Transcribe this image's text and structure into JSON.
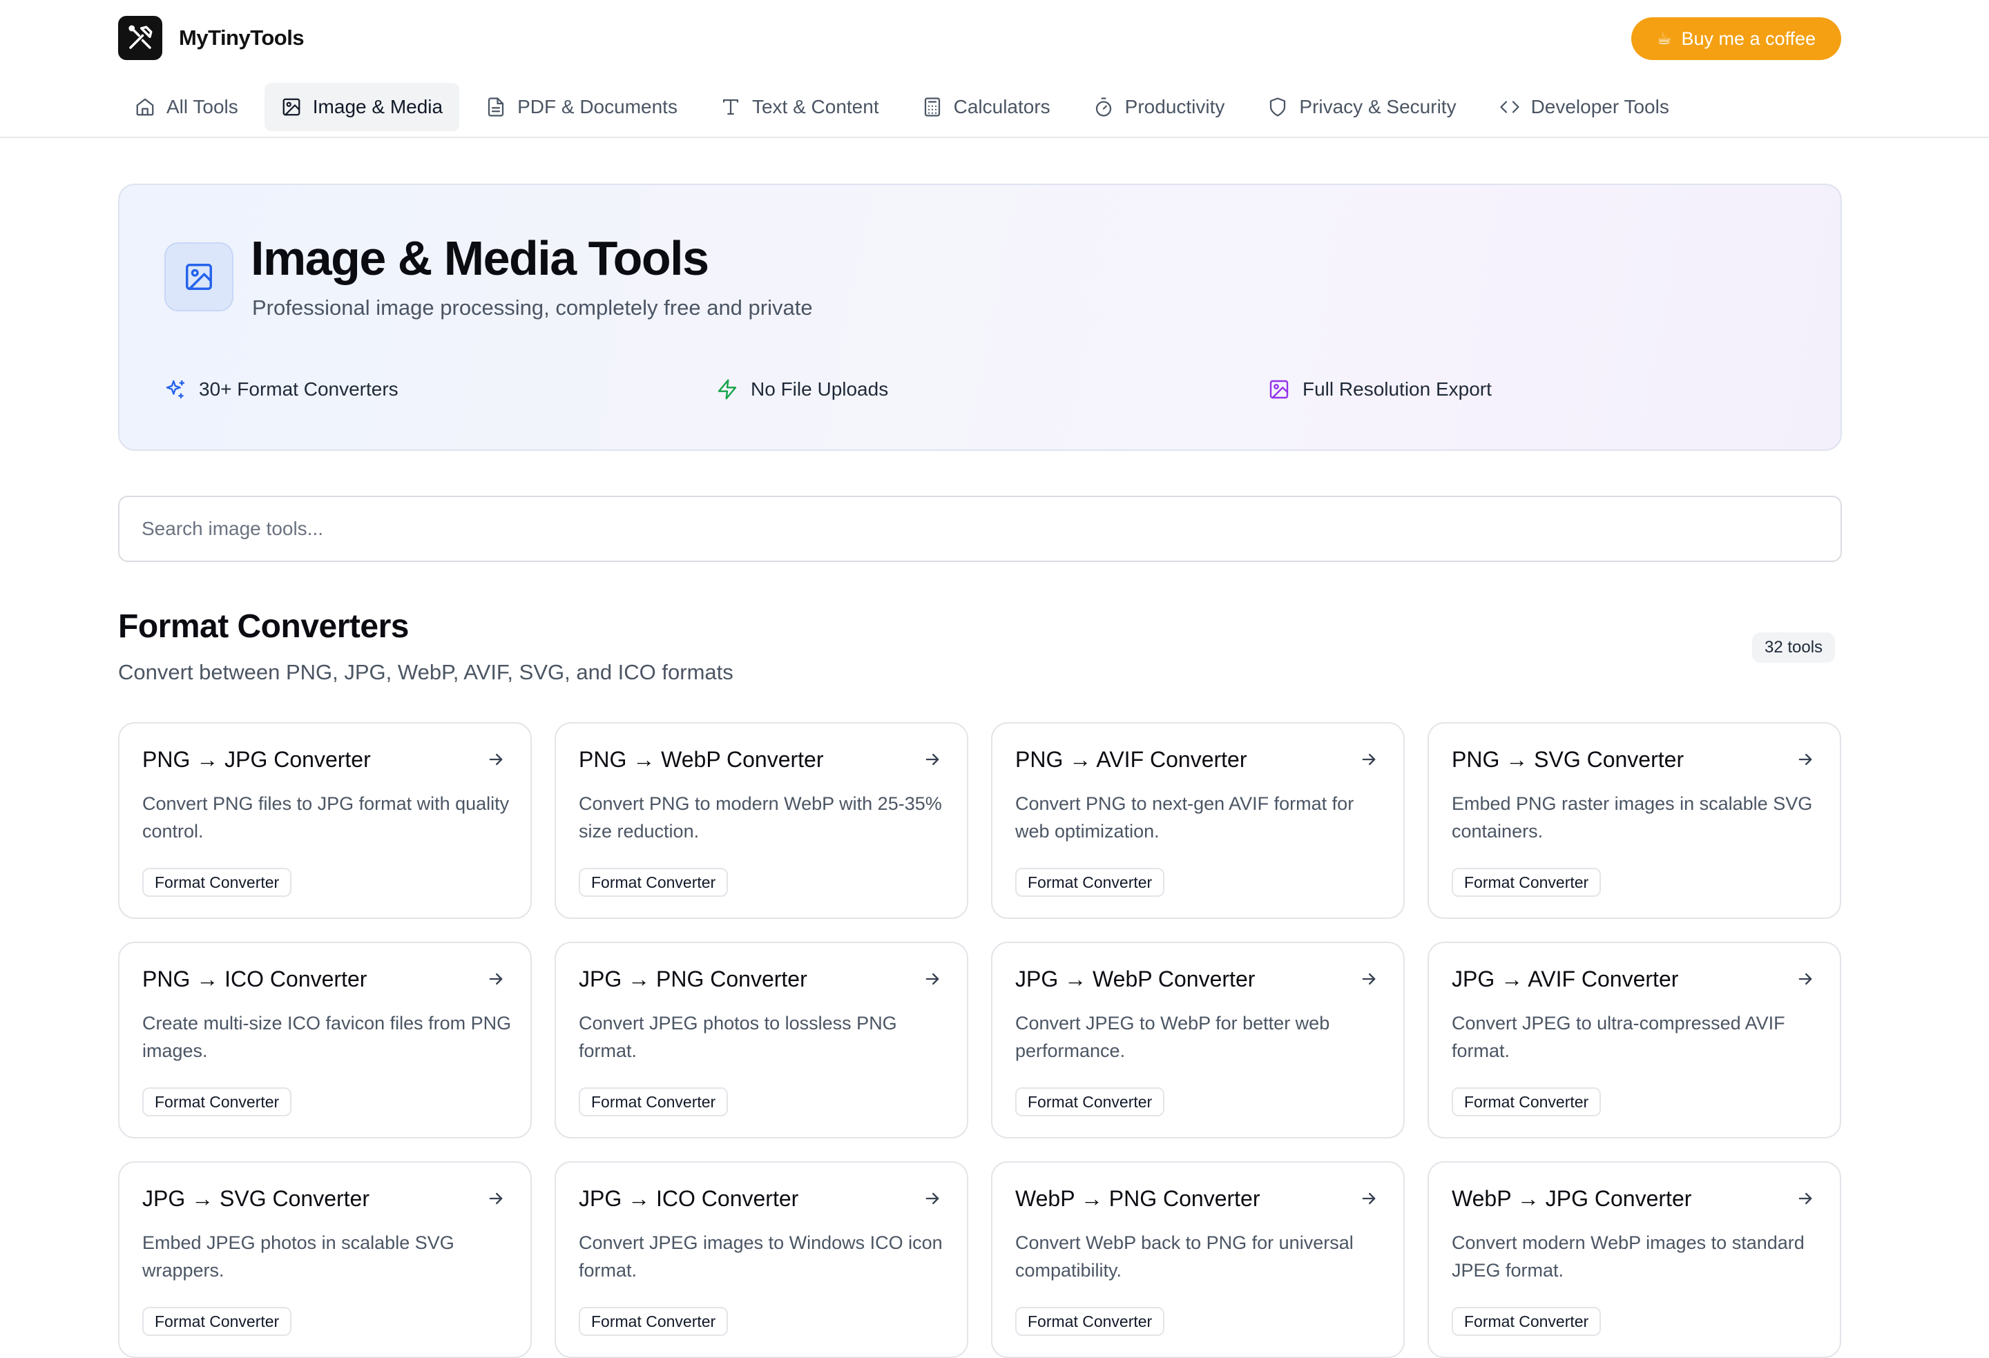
{
  "header": {
    "brand_name": "MyTinyTools",
    "coffee_icon": "☕",
    "coffee_label": "Buy me a coffee",
    "coffee_color": "#f4a012"
  },
  "nav": {
    "items": [
      {
        "label": "All Tools",
        "icon": "home-icon",
        "active": false
      },
      {
        "label": "Image & Media",
        "icon": "image-icon",
        "active": true
      },
      {
        "label": "PDF & Documents",
        "icon": "document-icon",
        "active": false
      },
      {
        "label": "Text & Content",
        "icon": "text-icon",
        "active": false
      },
      {
        "label": "Calculators",
        "icon": "calculator-icon",
        "active": false
      },
      {
        "label": "Productivity",
        "icon": "timer-icon",
        "active": false
      },
      {
        "label": "Privacy & Security",
        "icon": "shield-icon",
        "active": false
      },
      {
        "label": "Developer Tools",
        "icon": "code-icon",
        "active": false
      }
    ]
  },
  "hero": {
    "icon": "image-icon",
    "title": "Image & Media Tools",
    "subtitle": "Professional image processing, completely free and private",
    "features": [
      {
        "label": "30+ Format Converters",
        "icon": "sparkles-icon",
        "color": "#2563eb"
      },
      {
        "label": "No File Uploads",
        "icon": "lightning-icon",
        "color": "#16a34a"
      },
      {
        "label": "Full Resolution Export",
        "icon": "image-icon",
        "color": "#9333ea"
      }
    ]
  },
  "search": {
    "placeholder": "Search image tools...",
    "value": ""
  },
  "section": {
    "title": "Format Converters",
    "subtitle": "Convert between PNG, JPG, WebP, AVIF, SVG, and ICO formats",
    "count": "32 tools"
  },
  "cards": [
    {
      "title": "PNG → JPG Converter",
      "description": "Convert PNG files to JPG format with quality control.",
      "tag": "Format Converter"
    },
    {
      "title": "PNG → WebP Converter",
      "description": "Convert PNG to modern WebP with 25-35% size reduction.",
      "tag": "Format Converter"
    },
    {
      "title": "PNG → AVIF Converter",
      "description": "Convert PNG to next-gen AVIF format for web optimization.",
      "tag": "Format Converter"
    },
    {
      "title": "PNG → SVG Converter",
      "description": "Embed PNG raster images in scalable SVG containers.",
      "tag": "Format Converter"
    },
    {
      "title": "PNG → ICO Converter",
      "description": "Create multi-size ICO favicon files from PNG images.",
      "tag": "Format Converter"
    },
    {
      "title": "JPG → PNG Converter",
      "description": "Convert JPEG photos to lossless PNG format.",
      "tag": "Format Converter"
    },
    {
      "title": "JPG → WebP Converter",
      "description": "Convert JPEG to WebP for better web performance.",
      "tag": "Format Converter"
    },
    {
      "title": "JPG → AVIF Converter",
      "description": "Convert JPEG to ultra-compressed AVIF format.",
      "tag": "Format Converter"
    },
    {
      "title": "JPG → SVG Converter",
      "description": "Embed JPEG photos in scalable SVG wrappers.",
      "tag": "Format Converter"
    },
    {
      "title": "JPG → ICO Converter",
      "description": "Convert JPEG images to Windows ICO icon format.",
      "tag": "Format Converter"
    },
    {
      "title": "WebP → PNG Converter",
      "description": "Convert WebP back to PNG for universal compatibility.",
      "tag": "Format Converter"
    },
    {
      "title": "WebP → JPG Converter",
      "description": "Convert modern WebP images to standard JPEG format.",
      "tag": "Format Converter"
    }
  ]
}
